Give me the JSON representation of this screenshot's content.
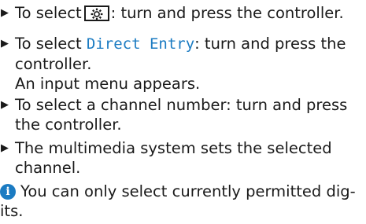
{
  "steps": [
    {
      "marker": "▶",
      "prefix": "To select",
      "icon": "gear-icon",
      "suffix": ": turn and press the controller."
    },
    {
      "marker": "▶",
      "prefix": "To select ",
      "ui_term": "Direct Entry",
      "suffix": ": turn and press the",
      "line2": "controller.",
      "line3": "An input menu appears."
    },
    {
      "marker": "▶",
      "line1": "To select a channel number: turn and press",
      "line2": "the controller."
    },
    {
      "marker": "▶",
      "line1": "The multimedia system sets the selected",
      "line2": "channel."
    }
  ],
  "note": {
    "icon": "info-icon",
    "icon_glyph": "i",
    "line1": "You can only select currently permitted dig-",
    "line2": "its."
  },
  "colors": {
    "text": "#1a1a1a",
    "accent_blue": "#1b7bc2",
    "background": "#ffffff"
  }
}
